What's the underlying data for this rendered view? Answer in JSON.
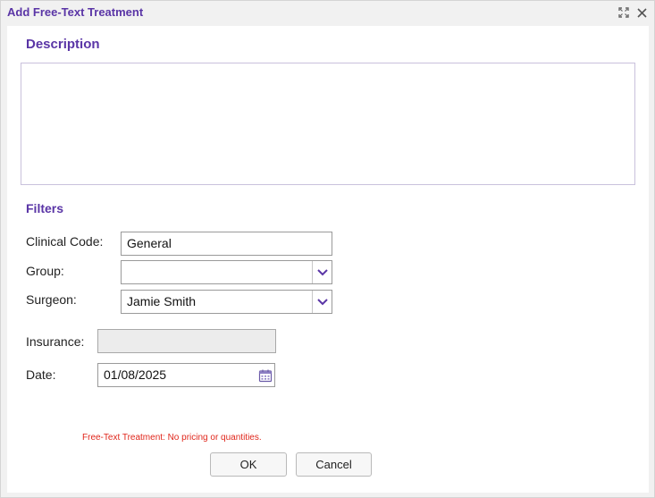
{
  "dialog": {
    "title": "Add Free-Text Treatment",
    "icons": {
      "maximize": "maximize-icon",
      "close": "close-icon"
    }
  },
  "description": {
    "heading": "Description",
    "value": ""
  },
  "filters": {
    "heading": "Filters",
    "clinical_code": {
      "label": "Clinical Code:",
      "value": "General"
    },
    "group": {
      "label": "Group:",
      "value": ""
    },
    "surgeon": {
      "label": "Surgeon:",
      "value": "Jamie Smith"
    },
    "insurance": {
      "label": "Insurance:",
      "value": ""
    },
    "date": {
      "label": "Date:",
      "value": "01/08/2025"
    }
  },
  "warning_text": "Free-Text Treatment: No pricing or quantities.",
  "buttons": {
    "ok": "OK",
    "cancel": "Cancel"
  },
  "colors": {
    "accent": "#5a35a6",
    "warning": "#e0261b",
    "dropdown_arrow": "#5a35a6"
  }
}
